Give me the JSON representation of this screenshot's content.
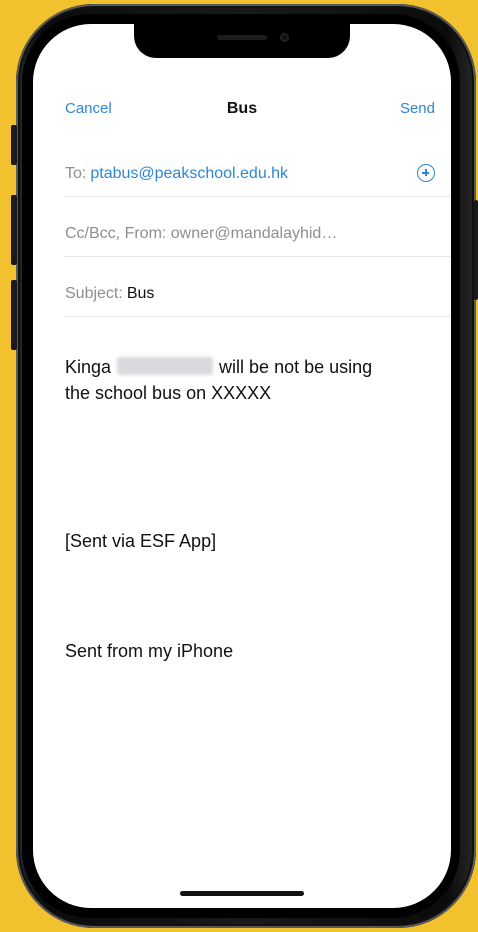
{
  "nav": {
    "cancel": "Cancel",
    "title": "Bus",
    "send": "Send"
  },
  "fields": {
    "to_label": "To:",
    "to_value": "ptabus@peakschool.edu.hk",
    "cc_text": "Cc/Bcc, From: owner@mandalayhidea...",
    "subject_label": "Subject:",
    "subject_value": "Bus"
  },
  "body": {
    "line1_start": "Kinga",
    "line1_end": "will be not be using",
    "line2": "the school bus on XXXXX",
    "app_line": "[Sent via ESF App]",
    "signature": "Sent from my iPhone"
  },
  "colors": {
    "background": "#f2c12e",
    "accent": "#2f86d4",
    "placeholder": "#8e8e93"
  },
  "icons": {
    "add_contact": "add-contact-icon"
  }
}
